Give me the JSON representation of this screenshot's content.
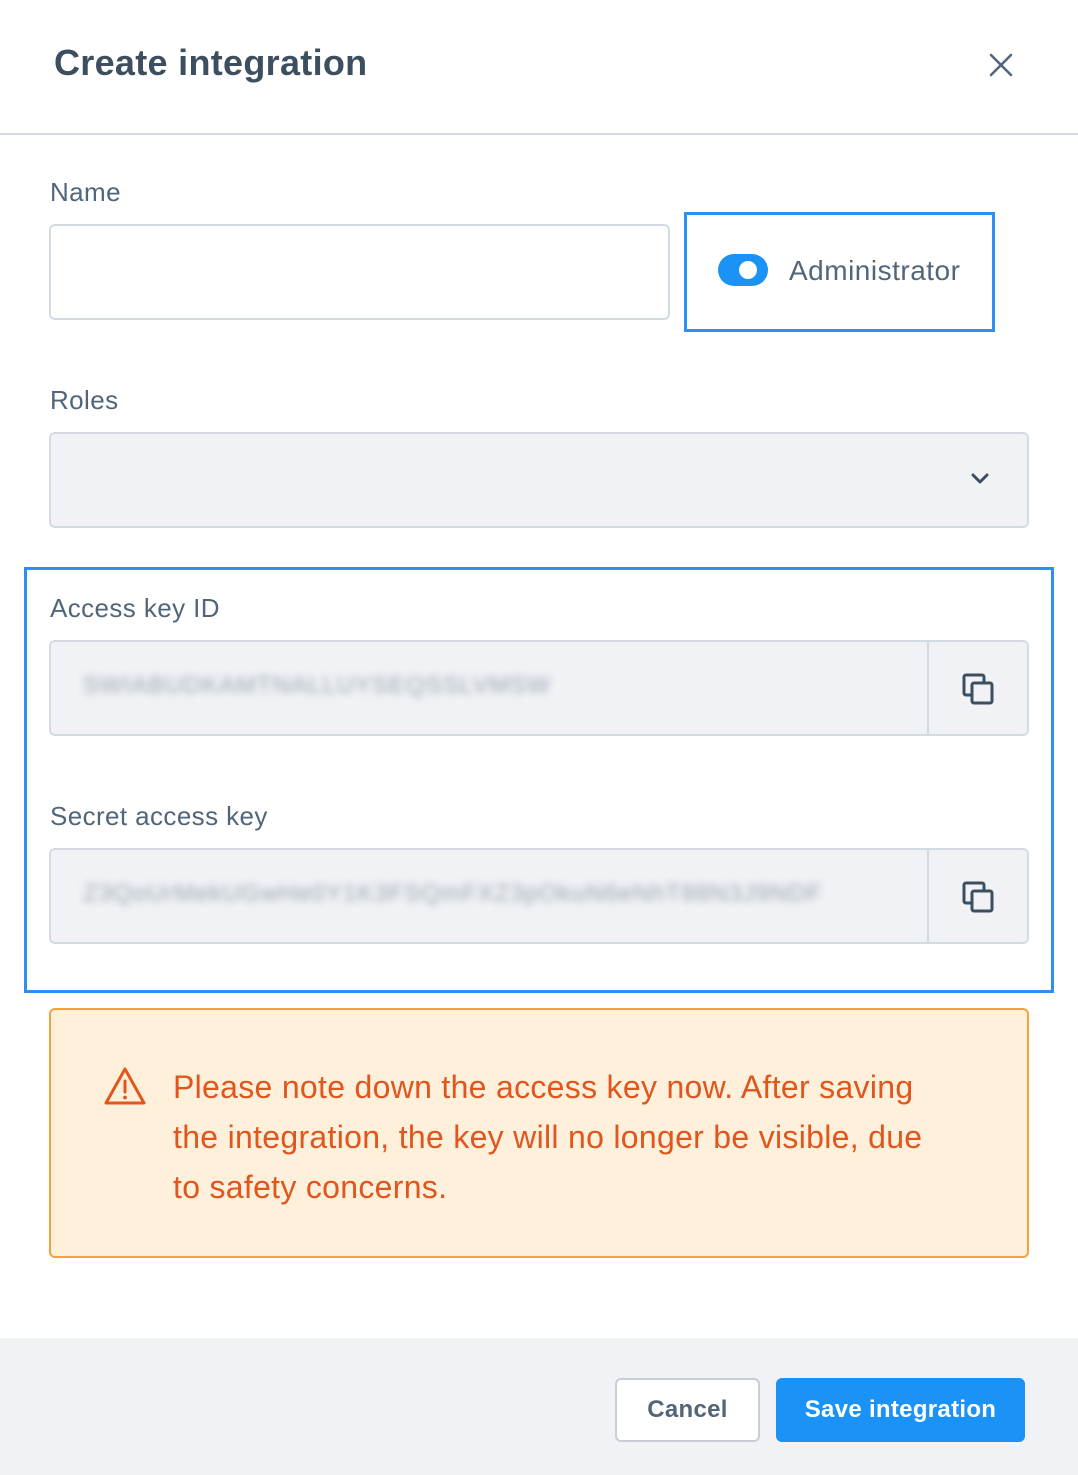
{
  "dialog": {
    "title": "Create integration",
    "close_icon": "close-icon"
  },
  "form": {
    "name": {
      "label": "Name",
      "value": "",
      "placeholder": ""
    },
    "administrator": {
      "label": "Administrator",
      "enabled": true
    },
    "roles": {
      "label": "Roles",
      "selected": "",
      "icon": "chevron-down-icon"
    },
    "access_key_id": {
      "label": "Access key ID",
      "value": "SWIABUDKAMTNALLUYSEQSSLVMSW",
      "copy_icon": "copy-icon"
    },
    "secret_access_key": {
      "label": "Secret access key",
      "value": "Z3QoUrMekUGwHe0Y1K3FSQmFXZ3pOkuN6eNhT88N3J9NDF",
      "copy_icon": "copy-icon"
    }
  },
  "warning": {
    "icon": "warning-triangle-icon",
    "text": "Please note down the access key now. After saving the integration, the key will no longer be visible, due to safety concerns."
  },
  "footer": {
    "cancel_label": "Cancel",
    "save_label": "Save integration"
  },
  "colors": {
    "accent": "#1b92f5",
    "highlight_border": "#2d8ff0",
    "warning_text": "#e0561c",
    "warning_bg": "#fff0dc",
    "warning_border": "#f5a23a"
  }
}
